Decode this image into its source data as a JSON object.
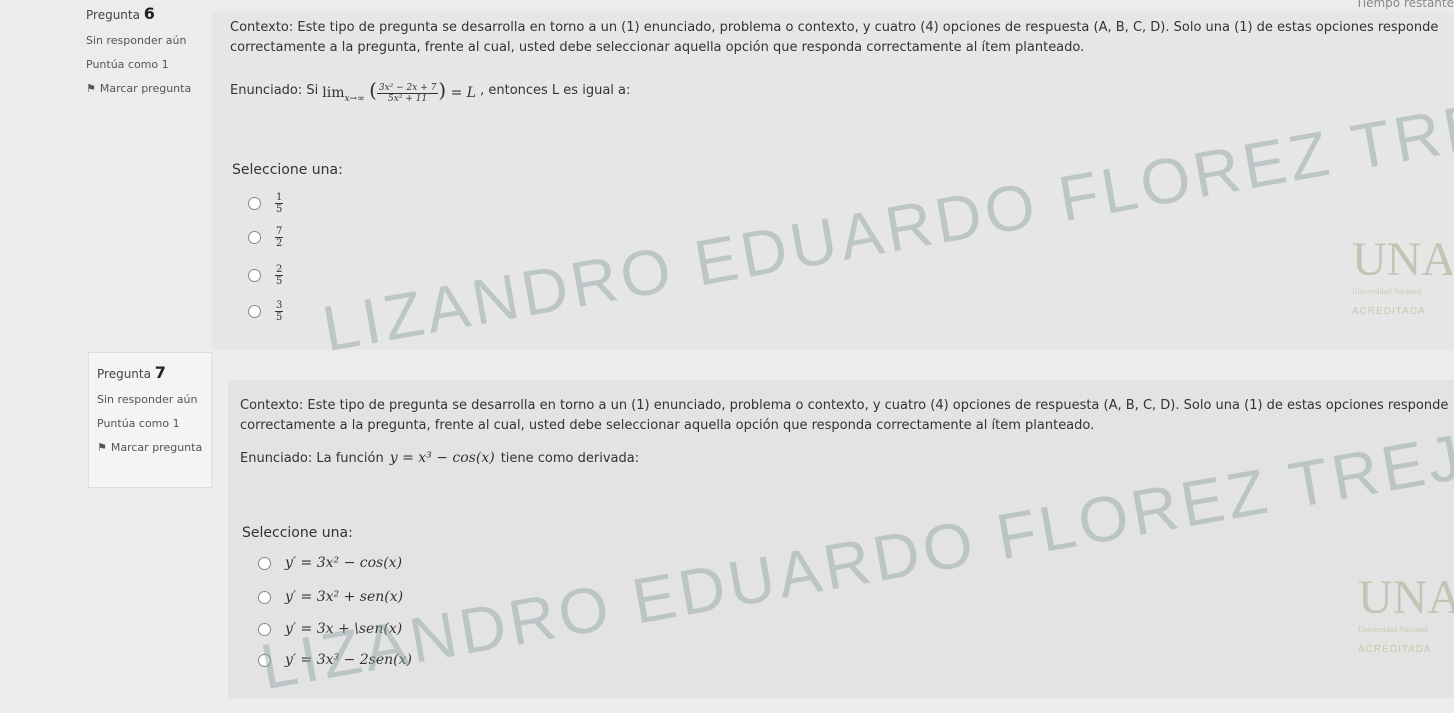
{
  "header": {
    "timer_label": "Tiempo restante"
  },
  "questions": [
    {
      "title_prefix": "Pregunta",
      "number": "6",
      "status": "Sin responder aún",
      "score": "Puntúa como 1",
      "flag_label": "Marcar pregunta",
      "context_line1": "Contexto: Este tipo de pregunta se desarrolla en torno a un (1) enunciado, problema o contexto, y cuatro (4) opciones de respuesta (A, B, C, D). Solo una (1) de estas opciones responde",
      "context_line2": "correctamente a la pregunta, frente al cual, usted debe seleccionar aquella opción que responda correctamente al ítem planteado.",
      "statement_prefix": "Enunciado: Si",
      "statement_limit": "lim",
      "statement_sub": "x→∞",
      "statement_num": "3x² − 2x + 7",
      "statement_den": "5x² + 11",
      "statement_eq": "= L",
      "statement_suffix": ", entonces L es igual a:",
      "select_label": "Seleccione una:",
      "options": [
        {
          "num": "1",
          "den": "5"
        },
        {
          "num": "7",
          "den": "2"
        },
        {
          "num": "2",
          "den": "5"
        },
        {
          "num": "3",
          "den": "5"
        }
      ],
      "watermark": "LIZANDRO EDUARDO FLOREZ TREJOS",
      "logo_letters": "UNAD",
      "logo_caption": "Universidad Nacional",
      "logo_badge": "ACREDITADA"
    },
    {
      "title_prefix": "Pregunta",
      "number": "7",
      "status": "Sin responder aún",
      "score": "Puntúa como 1",
      "flag_label": "Marcar pregunta",
      "context_line1": "Contexto: Este tipo de pregunta se desarrolla en torno a un (1) enunciado, problema o contexto, y cuatro (4) opciones de respuesta (A, B, C, D). Solo una (1) de estas opciones responde",
      "context_line2": "correctamente a la pregunta, frente al cual, usted debe seleccionar aquella opción que responda correctamente al ítem planteado.",
      "statement_prefix": "Enunciado: La función",
      "statement_math": "y = x³ − cos(x)",
      "statement_suffix": "tiene como derivada:",
      "select_label": "Seleccione una:",
      "options": [
        {
          "text": "y′ = 3x² − cos(x)"
        },
        {
          "text": "y′ = 3x² + sen(x)"
        },
        {
          "text": "y′ = 3x + \\sen(x)"
        },
        {
          "text": "y′ = 3x³ − 2sen(x)"
        }
      ],
      "watermark": "LIZANDRO EDUARDO FLOREZ TREJOS",
      "logo_letters": "UNAD",
      "logo_caption": "Universidad Nacional",
      "logo_badge": "ACREDITADA"
    }
  ]
}
